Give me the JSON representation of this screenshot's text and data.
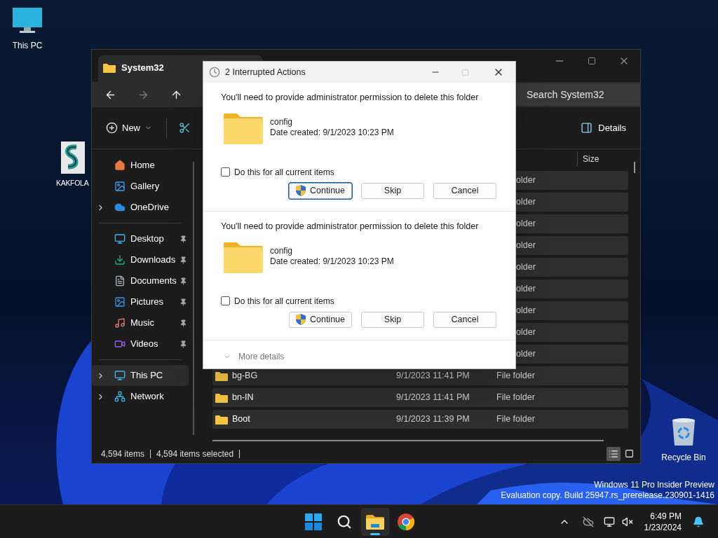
{
  "desktop": {
    "icons": [
      {
        "label": "This PC",
        "kind": "pc"
      },
      {
        "label": "KAKFOLA",
        "kind": "app"
      },
      {
        "label": "Recycle Bin",
        "kind": "bin"
      }
    ],
    "watermark": [
      "Windows 11 Pro Insider Preview",
      "Evaluation copy. Build 25947.rs_prerelease.230901-1416"
    ]
  },
  "explorer": {
    "tab_title": "System32",
    "search": {
      "placeholder": "Search System32"
    },
    "toolbar": {
      "new": "New",
      "details": "Details"
    },
    "sidebar": [
      [
        {
          "label": "Home",
          "kind": "home",
          "pinned": false,
          "expandable": false,
          "selected": false
        },
        {
          "label": "Gallery",
          "kind": "gallery",
          "pinned": false,
          "expandable": false,
          "selected": false
        },
        {
          "label": "OneDrive",
          "kind": "onedrive",
          "pinned": false,
          "expandable": true,
          "selected": false
        }
      ],
      [
        {
          "label": "Desktop",
          "kind": "desktop",
          "pinned": true,
          "expandable": false,
          "selected": false
        },
        {
          "label": "Downloads",
          "kind": "downloads",
          "pinned": true,
          "expandable": false,
          "selected": false
        },
        {
          "label": "Documents",
          "kind": "documents",
          "pinned": true,
          "expandable": false,
          "selected": false
        },
        {
          "label": "Pictures",
          "kind": "pictures",
          "pinned": true,
          "expandable": false,
          "selected": false
        },
        {
          "label": "Music",
          "kind": "music",
          "pinned": true,
          "expandable": false,
          "selected": false
        },
        {
          "label": "Videos",
          "kind": "videos",
          "pinned": true,
          "expandable": false,
          "selected": false
        }
      ],
      [
        {
          "label": "This PC",
          "kind": "pc",
          "pinned": false,
          "expandable": true,
          "selected": true
        },
        {
          "label": "Network",
          "kind": "network",
          "pinned": false,
          "expandable": true,
          "selected": false
        }
      ]
    ],
    "columns": [
      {
        "label": "Size"
      }
    ],
    "rows": [
      {
        "kind": "covered",
        "type": "older",
        "selected": true
      },
      {
        "kind": "covered",
        "type": "older",
        "selected": true
      },
      {
        "kind": "covered",
        "type": "older",
        "selected": true
      },
      {
        "kind": "covered",
        "type": "older",
        "selected": true
      },
      {
        "kind": "covered",
        "type": "older",
        "selected": true
      },
      {
        "kind": "covered",
        "type": "older",
        "selected": true
      },
      {
        "kind": "covered",
        "type": "older",
        "selected": true
      },
      {
        "kind": "covered",
        "type": "older",
        "selected": true
      },
      {
        "kind": "covered",
        "type": "older",
        "selected": true
      },
      {
        "kind": "full",
        "name": "bg-BG",
        "modified": "9/1/2023 11:41 PM",
        "type": "File folder",
        "selected": true
      },
      {
        "kind": "full",
        "name": "bn-IN",
        "modified": "9/1/2023 11:41 PM",
        "type": "File folder",
        "selected": true
      },
      {
        "kind": "full",
        "name": "Boot",
        "modified": "9/1/2023 11:39 PM",
        "type": "File folder",
        "selected": true
      }
    ],
    "status": {
      "items": "4,594 items",
      "selected": "4,594 items selected"
    },
    "views": [
      {
        "kind": "details",
        "selected": true
      },
      {
        "kind": "tiles",
        "selected": false
      }
    ]
  },
  "dialog": {
    "title": "2 Interrupted Actions",
    "actions": [
      {
        "message": "You'll need to provide administrator permission to delete this folder",
        "name": "config",
        "date": "Date created: 9/1/2023 10:23 PM",
        "checkbox": {
          "label": "Do this for all current items",
          "checked": false
        },
        "buttons": [
          {
            "label": "Continue",
            "kind": "shield",
            "focused": true
          },
          {
            "label": "Skip",
            "kind": "plain",
            "focused": false
          },
          {
            "label": "Cancel",
            "kind": "plain",
            "focused": false
          }
        ]
      },
      {
        "message": "You'll need to provide administrator permission to delete this folder",
        "name": "config",
        "date": "Date created: 9/1/2023 10:23 PM",
        "checkbox": {
          "label": "Do this for all current items",
          "checked": false
        },
        "buttons": [
          {
            "label": "Continue",
            "kind": "shield",
            "focused": false
          },
          {
            "label": "Skip",
            "kind": "plain",
            "focused": false
          },
          {
            "label": "Cancel",
            "kind": "plain",
            "focused": false
          }
        ]
      }
    ],
    "more_details": "More details"
  },
  "taskbar": {
    "apps": [
      {
        "kind": "start",
        "active": false
      },
      {
        "kind": "search",
        "active": false
      },
      {
        "kind": "explorer",
        "active": true
      },
      {
        "kind": "chrome",
        "active": false
      }
    ],
    "time": "6:49 PM",
    "date": "1/23/2024"
  }
}
